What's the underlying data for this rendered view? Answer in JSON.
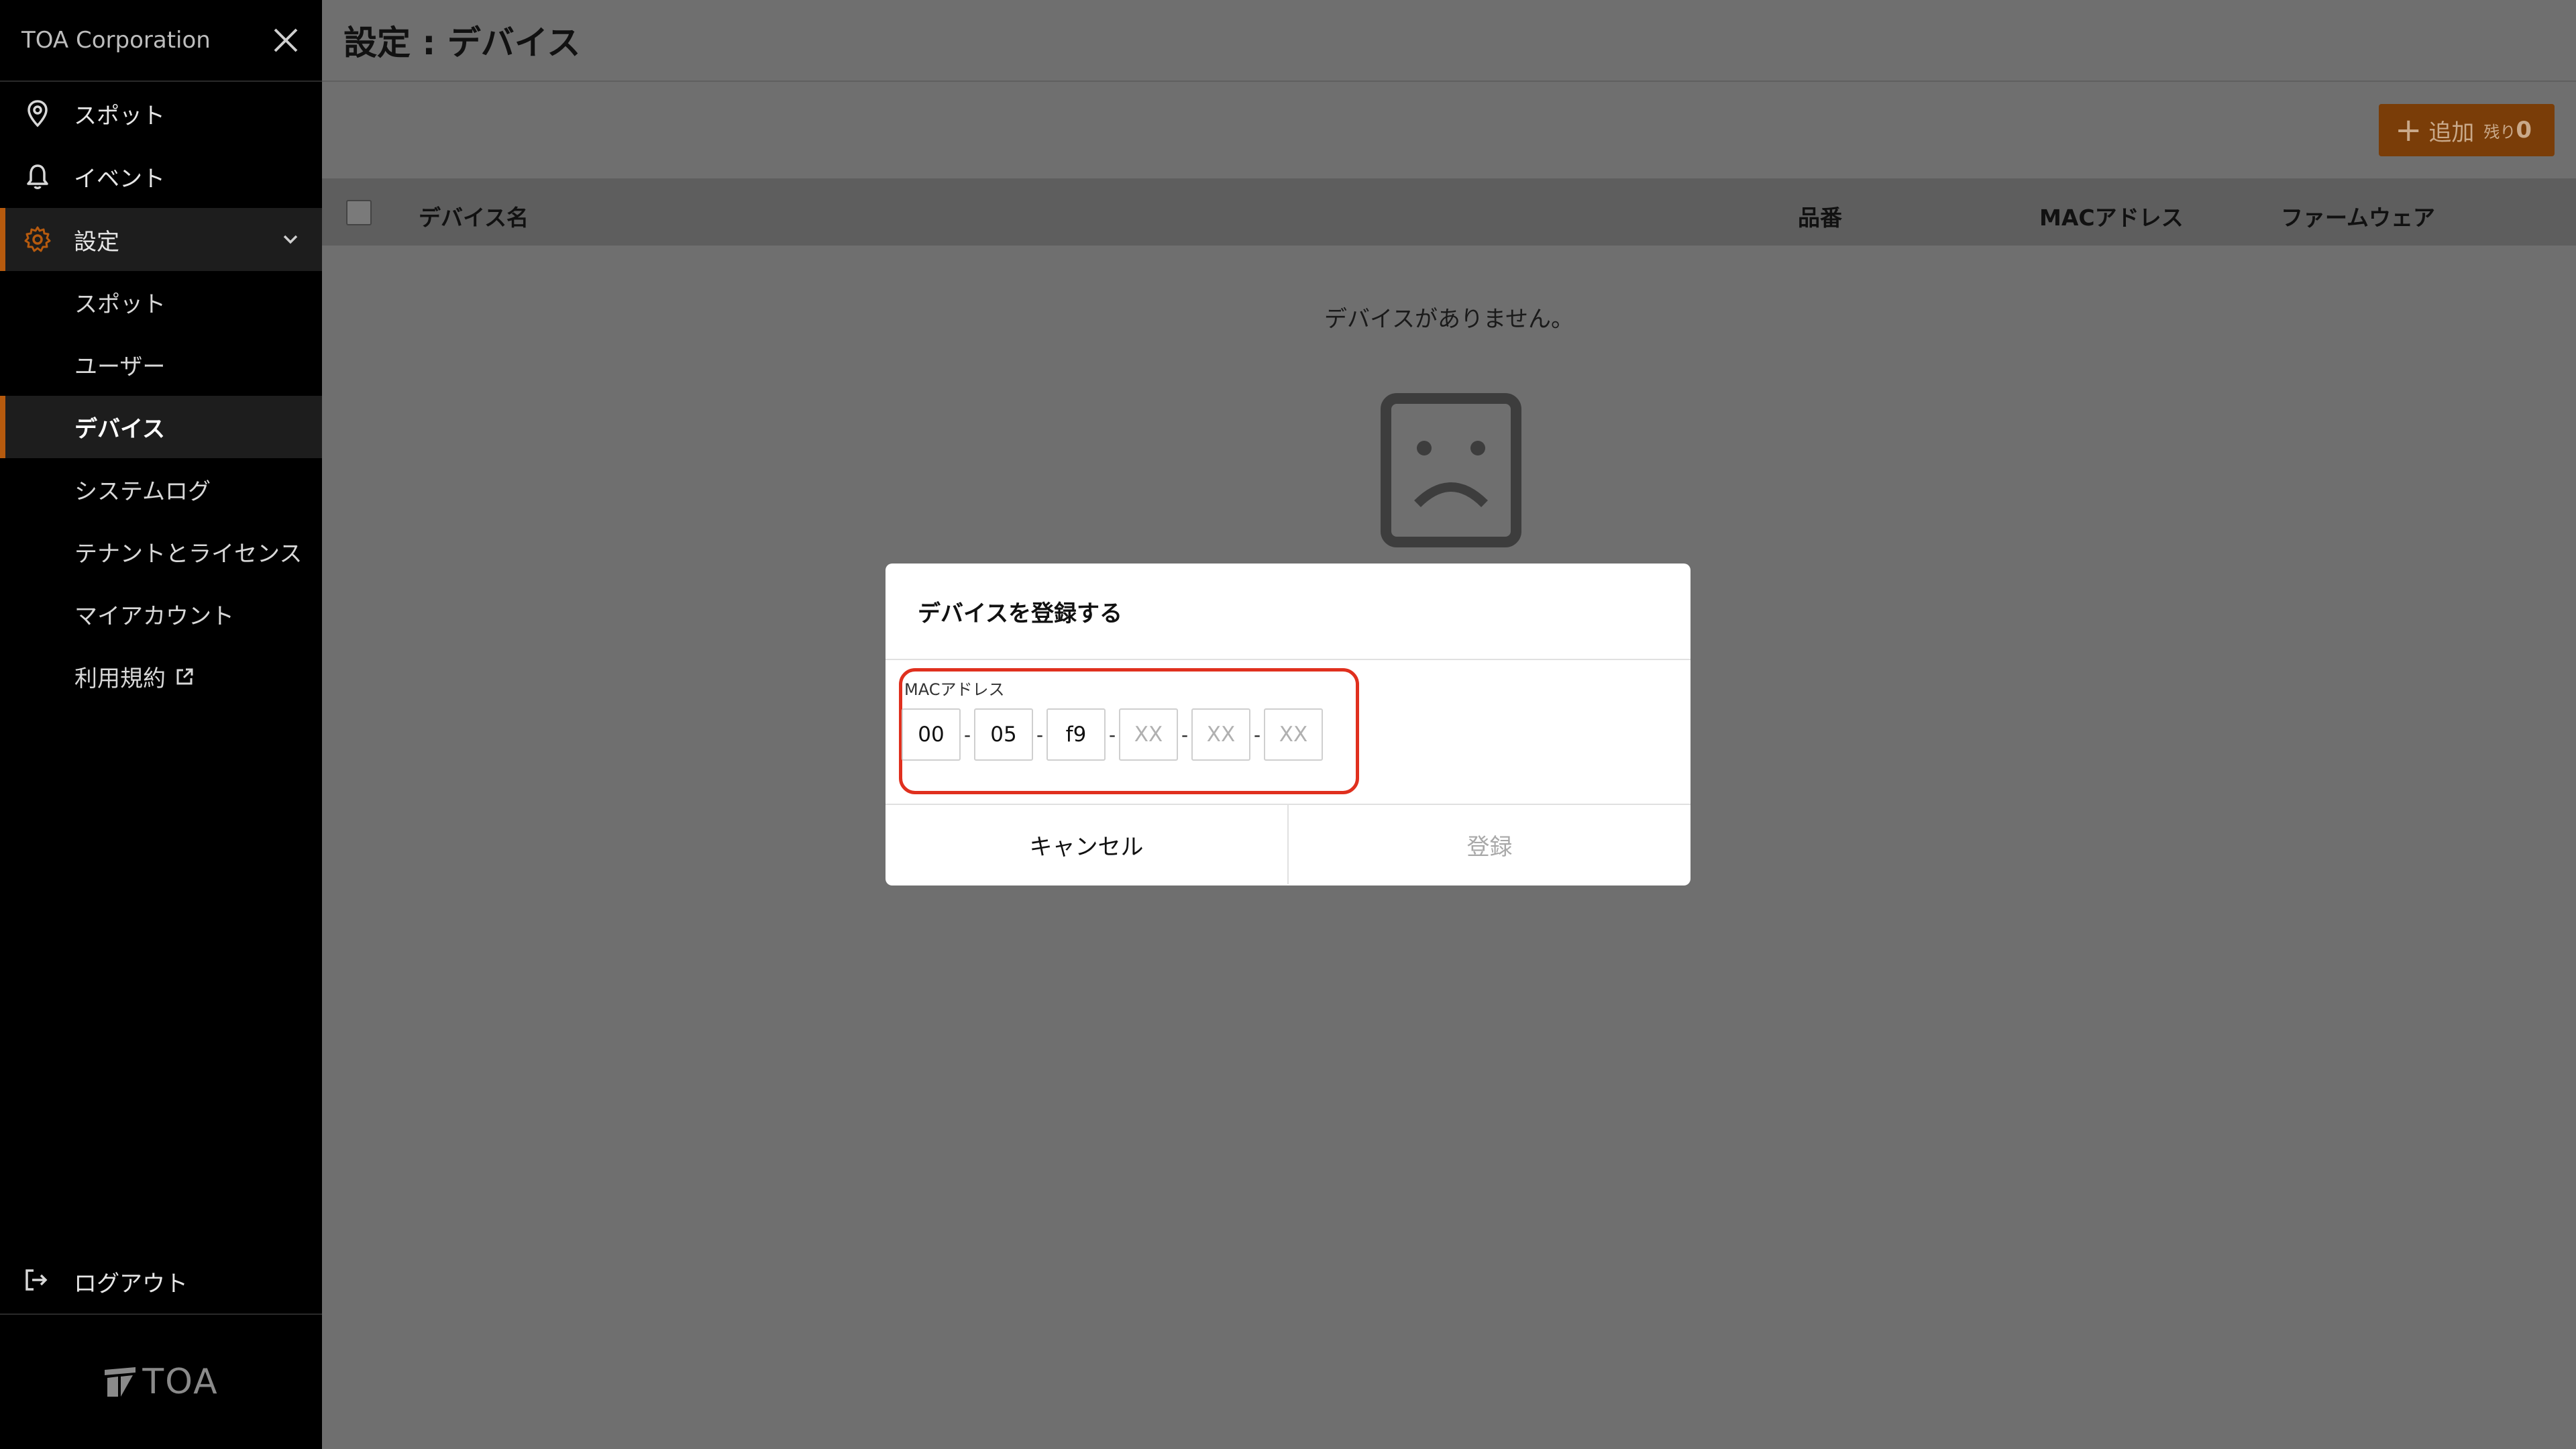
{
  "sidebar": {
    "org_name": "TOA Corporation",
    "nav": {
      "spot": "スポット",
      "event": "イベント",
      "settings": "設定"
    },
    "sub_items": [
      "スポット",
      "ユーザー",
      "デバイス",
      "システムログ",
      "テナントとライセンス",
      "マイアカウント",
      "利用規約"
    ],
    "active_sub": "デバイス",
    "logout": "ログアウト",
    "logo_text": "TOA"
  },
  "header": {
    "title": "設定 : デバイス"
  },
  "toolbar": {
    "add_label": "追加",
    "remaining_label": "残り",
    "remaining_count": "0"
  },
  "table": {
    "columns": [
      "デバイス名",
      "品番",
      "MACアドレス",
      "ファームウェア"
    ],
    "empty_message": "デバイスがありません。"
  },
  "modal": {
    "title": "デバイスを登録する",
    "mac_label": "MACアドレス",
    "octets": [
      {
        "value": "00",
        "placeholder": "XX"
      },
      {
        "value": "05",
        "placeholder": "XX"
      },
      {
        "value": "f9",
        "placeholder": "XX"
      },
      {
        "value": "",
        "placeholder": "XX"
      },
      {
        "value": "",
        "placeholder": "XX"
      },
      {
        "value": "",
        "placeholder": "XX"
      }
    ],
    "separator": "-",
    "cancel_label": "キャンセル",
    "submit_label": "登録"
  },
  "colors": {
    "accent": "#b65a0e",
    "add_button_dimmed": "#7a3d08",
    "highlight_outline": "#e0301e"
  }
}
